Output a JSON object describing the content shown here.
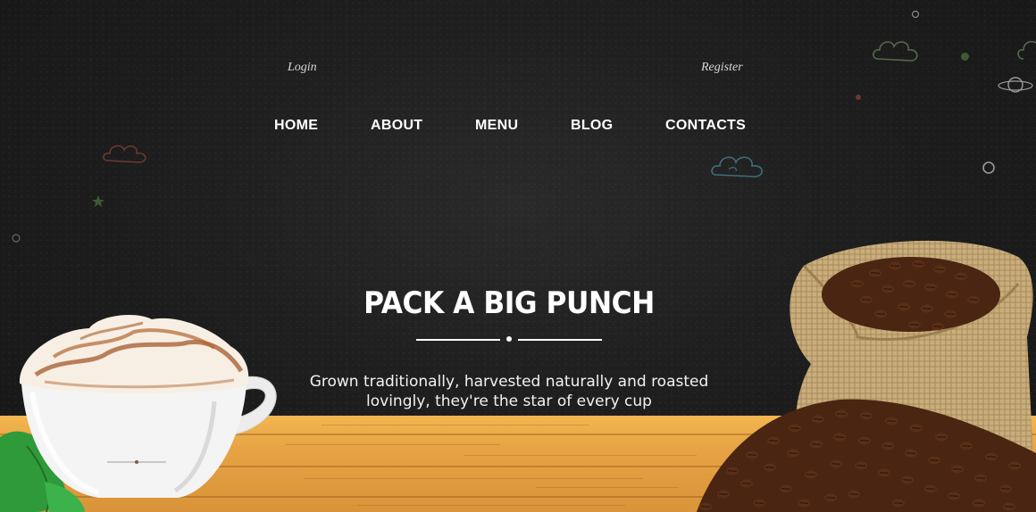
{
  "auth": {
    "login_label": "Login",
    "register_label": "Register"
  },
  "nav": {
    "items": [
      "HOME",
      "ABOUT",
      "MENU",
      "BLOG",
      "CONTACTS"
    ]
  },
  "hero": {
    "title": "PACK A BIG PUNCH",
    "subtitle": "Grown traditionally, harvested naturally and roasted lovingly, they're the star of every cup"
  },
  "icons": {
    "clouds": "chalk-cloud-icon",
    "planet": "chalk-planet-icon",
    "star": "chalk-star-icon",
    "circle": "chalk-circle-icon"
  },
  "colors": {
    "background": "#1c1c1c",
    "text": "#ffffff",
    "wood": "#e7a343",
    "coffee_bean": "#5a2f17",
    "burlap": "#c9ad7c",
    "cup": "#f4f4f4"
  }
}
